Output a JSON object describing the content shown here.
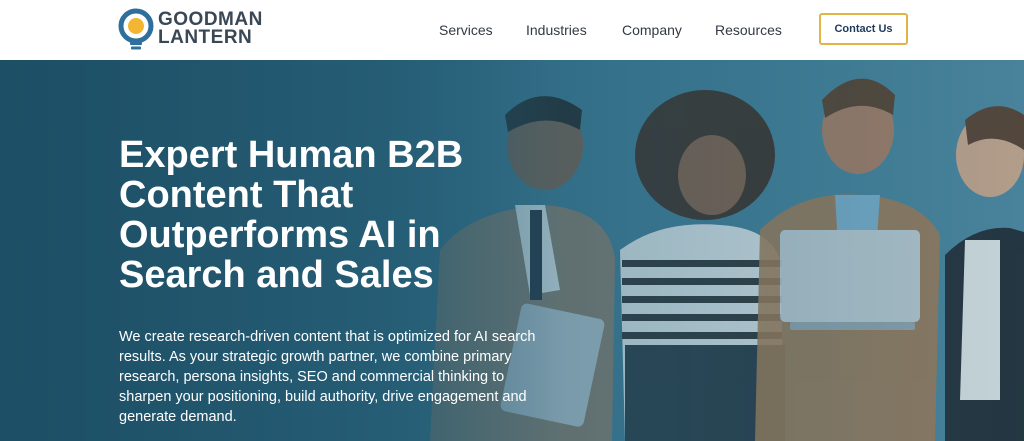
{
  "brand": {
    "line1": "GOODMAN",
    "line2": "LANTERN",
    "colors": {
      "ring_blue": "#2f6f9c",
      "bulb_yellow": "#f2b632",
      "text": "#3a4755"
    }
  },
  "nav": {
    "items": [
      {
        "label": "Services"
      },
      {
        "label": "Industries"
      },
      {
        "label": "Company"
      },
      {
        "label": "Resources"
      }
    ],
    "cta_label": "Contact Us",
    "cta_border": "#e0b445"
  },
  "hero": {
    "headline_lines": [
      "Expert Human B2B",
      "Content That",
      "Outperforms AI in",
      "Search and Sales"
    ],
    "body_lines": [
      "We create research-driven content that is optimized for AI search",
      "results. As your strategic growth partner, we combine primary",
      "research, persona insights, SEO and commercial thinking to",
      "sharpen your positioning, build authority, drive engagement and",
      "generate demand."
    ],
    "background_color": "#2d6780"
  }
}
